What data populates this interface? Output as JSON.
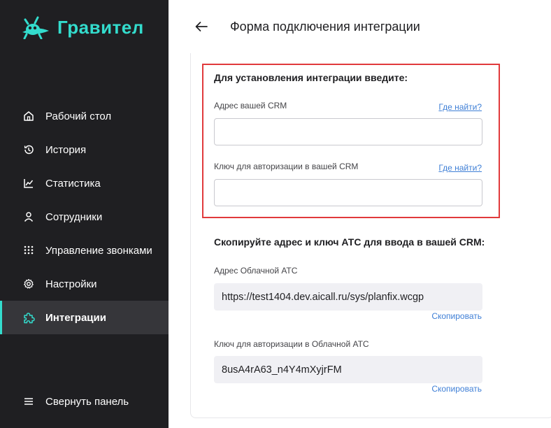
{
  "brand": {
    "name": "Гравител",
    "accent": "#33dccd"
  },
  "sidebar": {
    "items": [
      {
        "label": "Рабочий стол",
        "icon": "home-icon"
      },
      {
        "label": "История",
        "icon": "history-icon"
      },
      {
        "label": "Статистика",
        "icon": "chart-line-icon"
      },
      {
        "label": "Сотрудники",
        "icon": "user-icon"
      },
      {
        "label": "Управление звонками",
        "icon": "dialpad-icon"
      },
      {
        "label": "Настройки",
        "icon": "gear-icon"
      },
      {
        "label": "Интеграции",
        "icon": "puzzle-icon",
        "active": true
      }
    ],
    "collapse_label": "Свернуть панель"
  },
  "header": {
    "title": "Форма подключения интеграции"
  },
  "form": {
    "enter_title": "Для установления интеграции введите:",
    "crm_address_label": "Адрес вашей CRM",
    "crm_address_value": "",
    "crm_key_label": "Ключ для авторизации в вашей CRM",
    "crm_key_value": "",
    "help_link": "Где найти?",
    "copy_title": "Скопируйте адрес и ключ АТС для ввода в вашей CRM:",
    "ats_address_label": "Адрес Облачной АТС",
    "ats_address_value": "https://test1404.dev.aicall.ru/sys/planfix.wcgp",
    "ats_key_label": "Ключ для авторизации в Облачной АТС",
    "ats_key_value": "8usA4rA63_n4Y4mXyjrFM",
    "copy_label": "Скопировать"
  },
  "colors": {
    "highlight": "#e13a3c",
    "link": "#3f7fd6",
    "sidebar_bg": "#1f1f22"
  }
}
